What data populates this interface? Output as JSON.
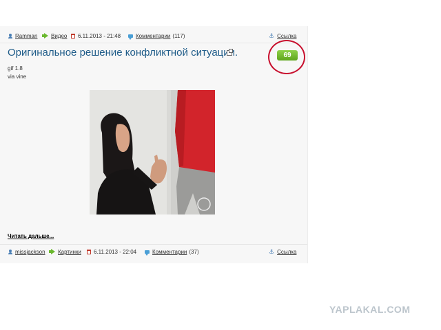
{
  "post": {
    "author": "Ramman",
    "category": "Видео",
    "date": "6.11.2013 - 21:48",
    "comments": "Комментарии",
    "comments_count": "(117)",
    "link": "Ссылка",
    "title": "Оригинальное решение конфликтной ситуации.",
    "line1": "gif 1.8",
    "line2": "via vine",
    "rating": "69",
    "read_more": "Читать дальше..."
  },
  "next_post": {
    "author": "missjackson",
    "category": "Картинки",
    "date": "6.11.2013 - 22:04",
    "comments": "Комментарии",
    "comments_count": "(37)",
    "link": "Ссылка"
  },
  "watermark": "YAPLAKAL.COM",
  "icons": [
    "user-icon",
    "arrow-icon",
    "calendar-icon",
    "comment-icon",
    "anchor-icon",
    "external-window-icon"
  ],
  "colors": {
    "title": "#1f5c89",
    "rating_badge": "#6ab82e",
    "highlight_circle": "#c8102e",
    "watermark": "#bcc5cc"
  }
}
